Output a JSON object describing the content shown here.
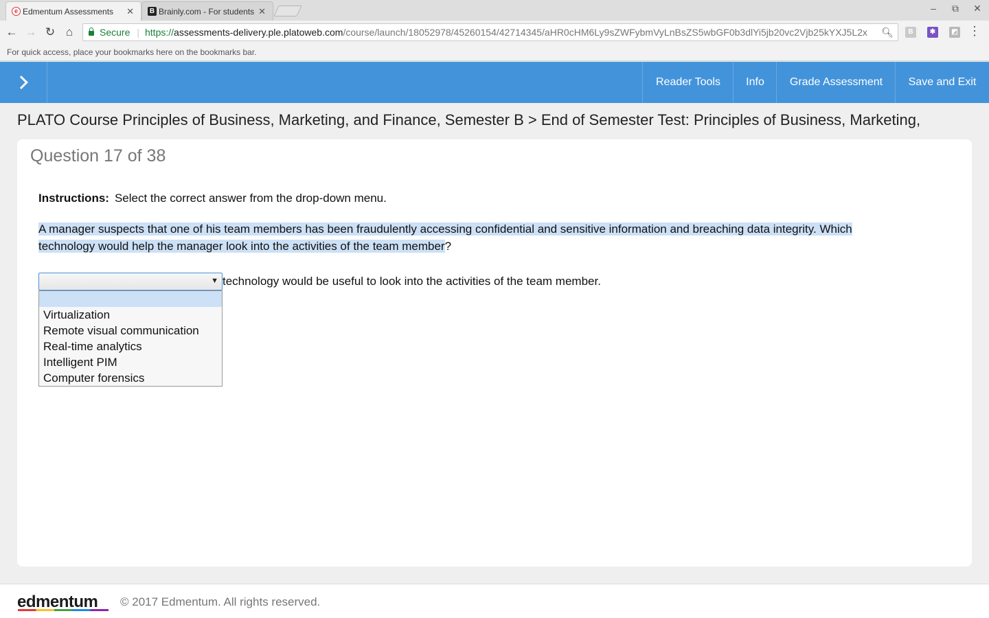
{
  "browser": {
    "tabs": [
      {
        "title": "Edmentum Assessments",
        "active": true
      },
      {
        "title": "Brainly.com - For students",
        "active": false
      }
    ],
    "window_controls": {
      "minimize": "–",
      "maximize": "⧉",
      "close": "✕"
    },
    "nav": {
      "back": "←",
      "forward": "→",
      "reload": "↻",
      "home": "⌂"
    },
    "address": {
      "secure_label": "Secure",
      "protocol": "https://",
      "host": "assessments-delivery.ple.platoweb.com",
      "path": "/course/launch/18052978/45260154/42714345/aHR0cHM6Ly9sZWFybmVyLnBsZS5wbGF0b3dlYi5jb20vc2Vjb25kYXJ5L2x"
    },
    "bookmarks_hint": "For quick access, place your bookmarks here on the bookmarks bar."
  },
  "header": {
    "nav": [
      "Reader Tools",
      "Info",
      "Grade Assessment",
      "Save and Exit"
    ]
  },
  "breadcrumb": "PLATO Course Principles of Business, Marketing, and Finance, Semester B > End of Semester Test: Principles of Business, Marketing,",
  "question": {
    "number_label": "Question 17 of 38",
    "instructions_label": "Instructions:",
    "instructions_text": "Select the correct answer from the drop-down menu.",
    "prompt_highlighted": "A manager suspects that one of his team members has been fraudulently accessing confidential and sensitive information and breaching data integrity. Which technology would help the manager look into the activities of the team member",
    "prompt_end": "?",
    "answer_suffix": "technology would be useful to look into the activities of the team member.",
    "dropdown": {
      "selected_value": "",
      "options": [
        "",
        "Virtualization",
        "Remote visual communication",
        "Real-time analytics",
        "Intelligent PIM",
        "Computer forensics"
      ]
    }
  },
  "footer": {
    "logo": "edmentum",
    "copyright": "© 2017 Edmentum. All rights reserved."
  },
  "colors": {
    "header_blue": "#4393db",
    "highlight": "#cce0f6",
    "secure_green": "#188038"
  }
}
